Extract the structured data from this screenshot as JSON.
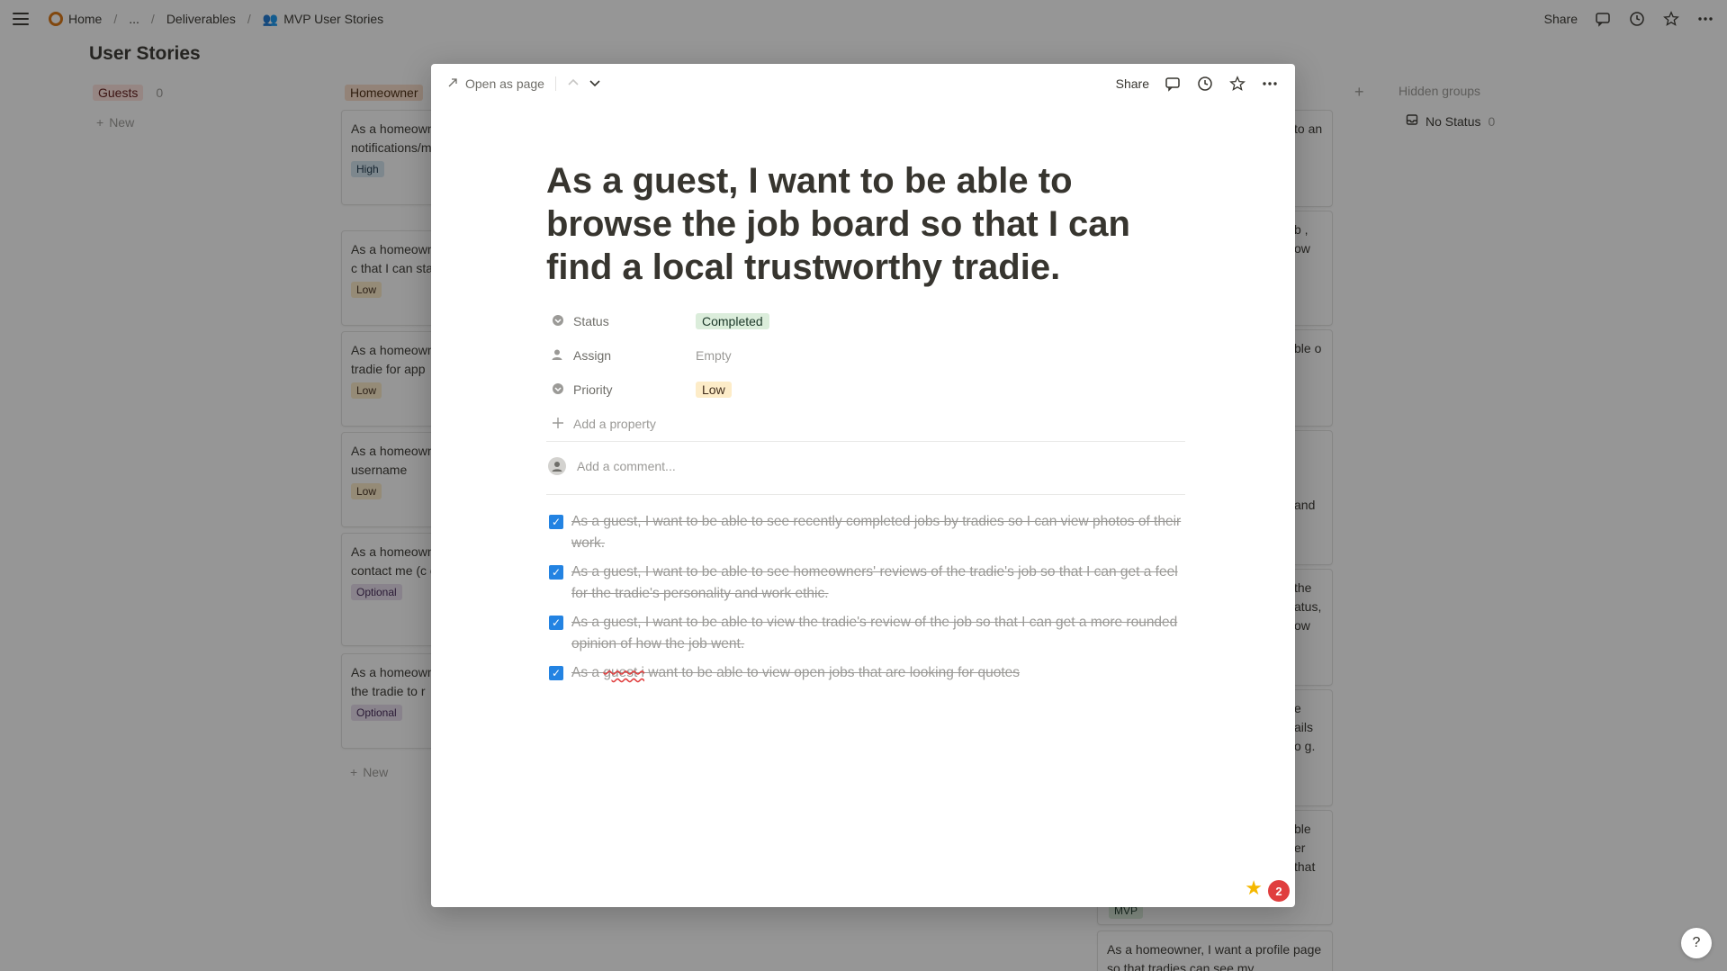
{
  "topbar": {
    "breadcrumb": [
      "Home",
      "...",
      "Deliverables",
      "MVP User Stories"
    ],
    "share_label": "Share"
  },
  "board": {
    "title": "User Stories",
    "columns": [
      {
        "label": "Guests",
        "count": "0",
        "new_label": "New"
      },
      {
        "label": "Homeowner",
        "new_label": "New"
      }
    ],
    "homeowner_cards": [
      {
        "text": "As a homeowner, I want to see my notifications/m that I know wh",
        "priority": "High"
      },
      {
        "text": "As a homeowner, I want to approve a c that I can star",
        "priority": "Low"
      },
      {
        "text": "As a homeowner, I want to edit a job a tradie for app",
        "priority": "Low"
      },
      {
        "text": "As a homeowner, I want invite a tradie username",
        "priority": "Low"
      },
      {
        "text": "As a homeowner, I want message butt contact me (c connected).",
        "priority": "Optional"
      },
      {
        "text": "As a homeowner, I want to submit con the tradie to r",
        "priority": "Optional"
      }
    ],
    "right_fragments": [
      {
        "text": "to an"
      },
      {
        "text": "b , ow"
      },
      {
        "text": "ble o"
      },
      {
        "text": "and"
      },
      {
        "text": "the atus, ow"
      },
      {
        "text": "e ails o g."
      },
      {
        "text": "ble er that"
      },
      {
        "text": "As a homeowner, I want a profile page so that tradies can see my"
      }
    ],
    "mvp_tag": "MVP",
    "hidden_groups_label": "Hidden groups",
    "no_status_label": "No Status",
    "no_status_count": "0"
  },
  "modal": {
    "open_as_page": "Open as page",
    "share_label": "Share",
    "title": "As a guest, I want to be able to browse the job board so that I can find a local trustworthy tradie.",
    "properties": {
      "status_label": "Status",
      "status_value": "Completed",
      "assign_label": "Assign",
      "assign_value": "Empty",
      "priority_label": "Priority",
      "priority_value": "Low",
      "add_property": "Add a property"
    },
    "comment_placeholder": "Add a comment...",
    "todos": [
      {
        "text": "As a guest, I want to be able to see recently completed jobs by tradies so I can view photos of their work.",
        "checked": true
      },
      {
        "text": "As a guest, I want to be able to see homeowners' reviews of the tradie's job so that I can get a feel for the tradie's personality and work ethic.",
        "checked": true
      },
      {
        "text": "As a guest, I want to be able to view the tradie's review of the job so that I can get a more rounded opinion of how the job went.",
        "checked": true
      },
      {
        "text_pre": "As a ",
        "text_spell": "guest i",
        "text_post": " want to be able to view open jobs that are looking for quotes",
        "checked": true
      }
    ],
    "notification_count": "2"
  },
  "help_label": "?"
}
